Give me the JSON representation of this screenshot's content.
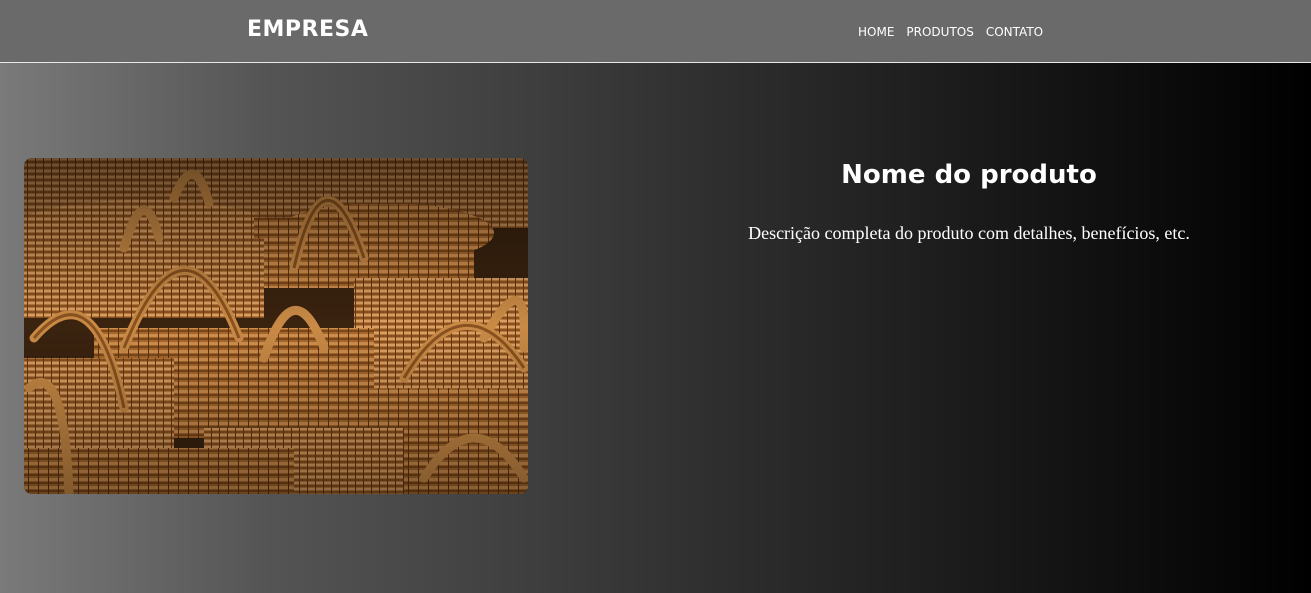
{
  "header": {
    "logo": "EMPRESA",
    "nav": [
      {
        "label": "HOME"
      },
      {
        "label": "PRODUTOS"
      },
      {
        "label": "CONTATO"
      }
    ]
  },
  "product": {
    "title": "Nome do produto",
    "description": "Descrição completa do produto com detalhes, benefícios, etc."
  },
  "colors": {
    "header_bg": "#6a6a6a",
    "text": "#ffffff",
    "gradient_start": "#7a7a7a",
    "gradient_end": "#000000"
  }
}
